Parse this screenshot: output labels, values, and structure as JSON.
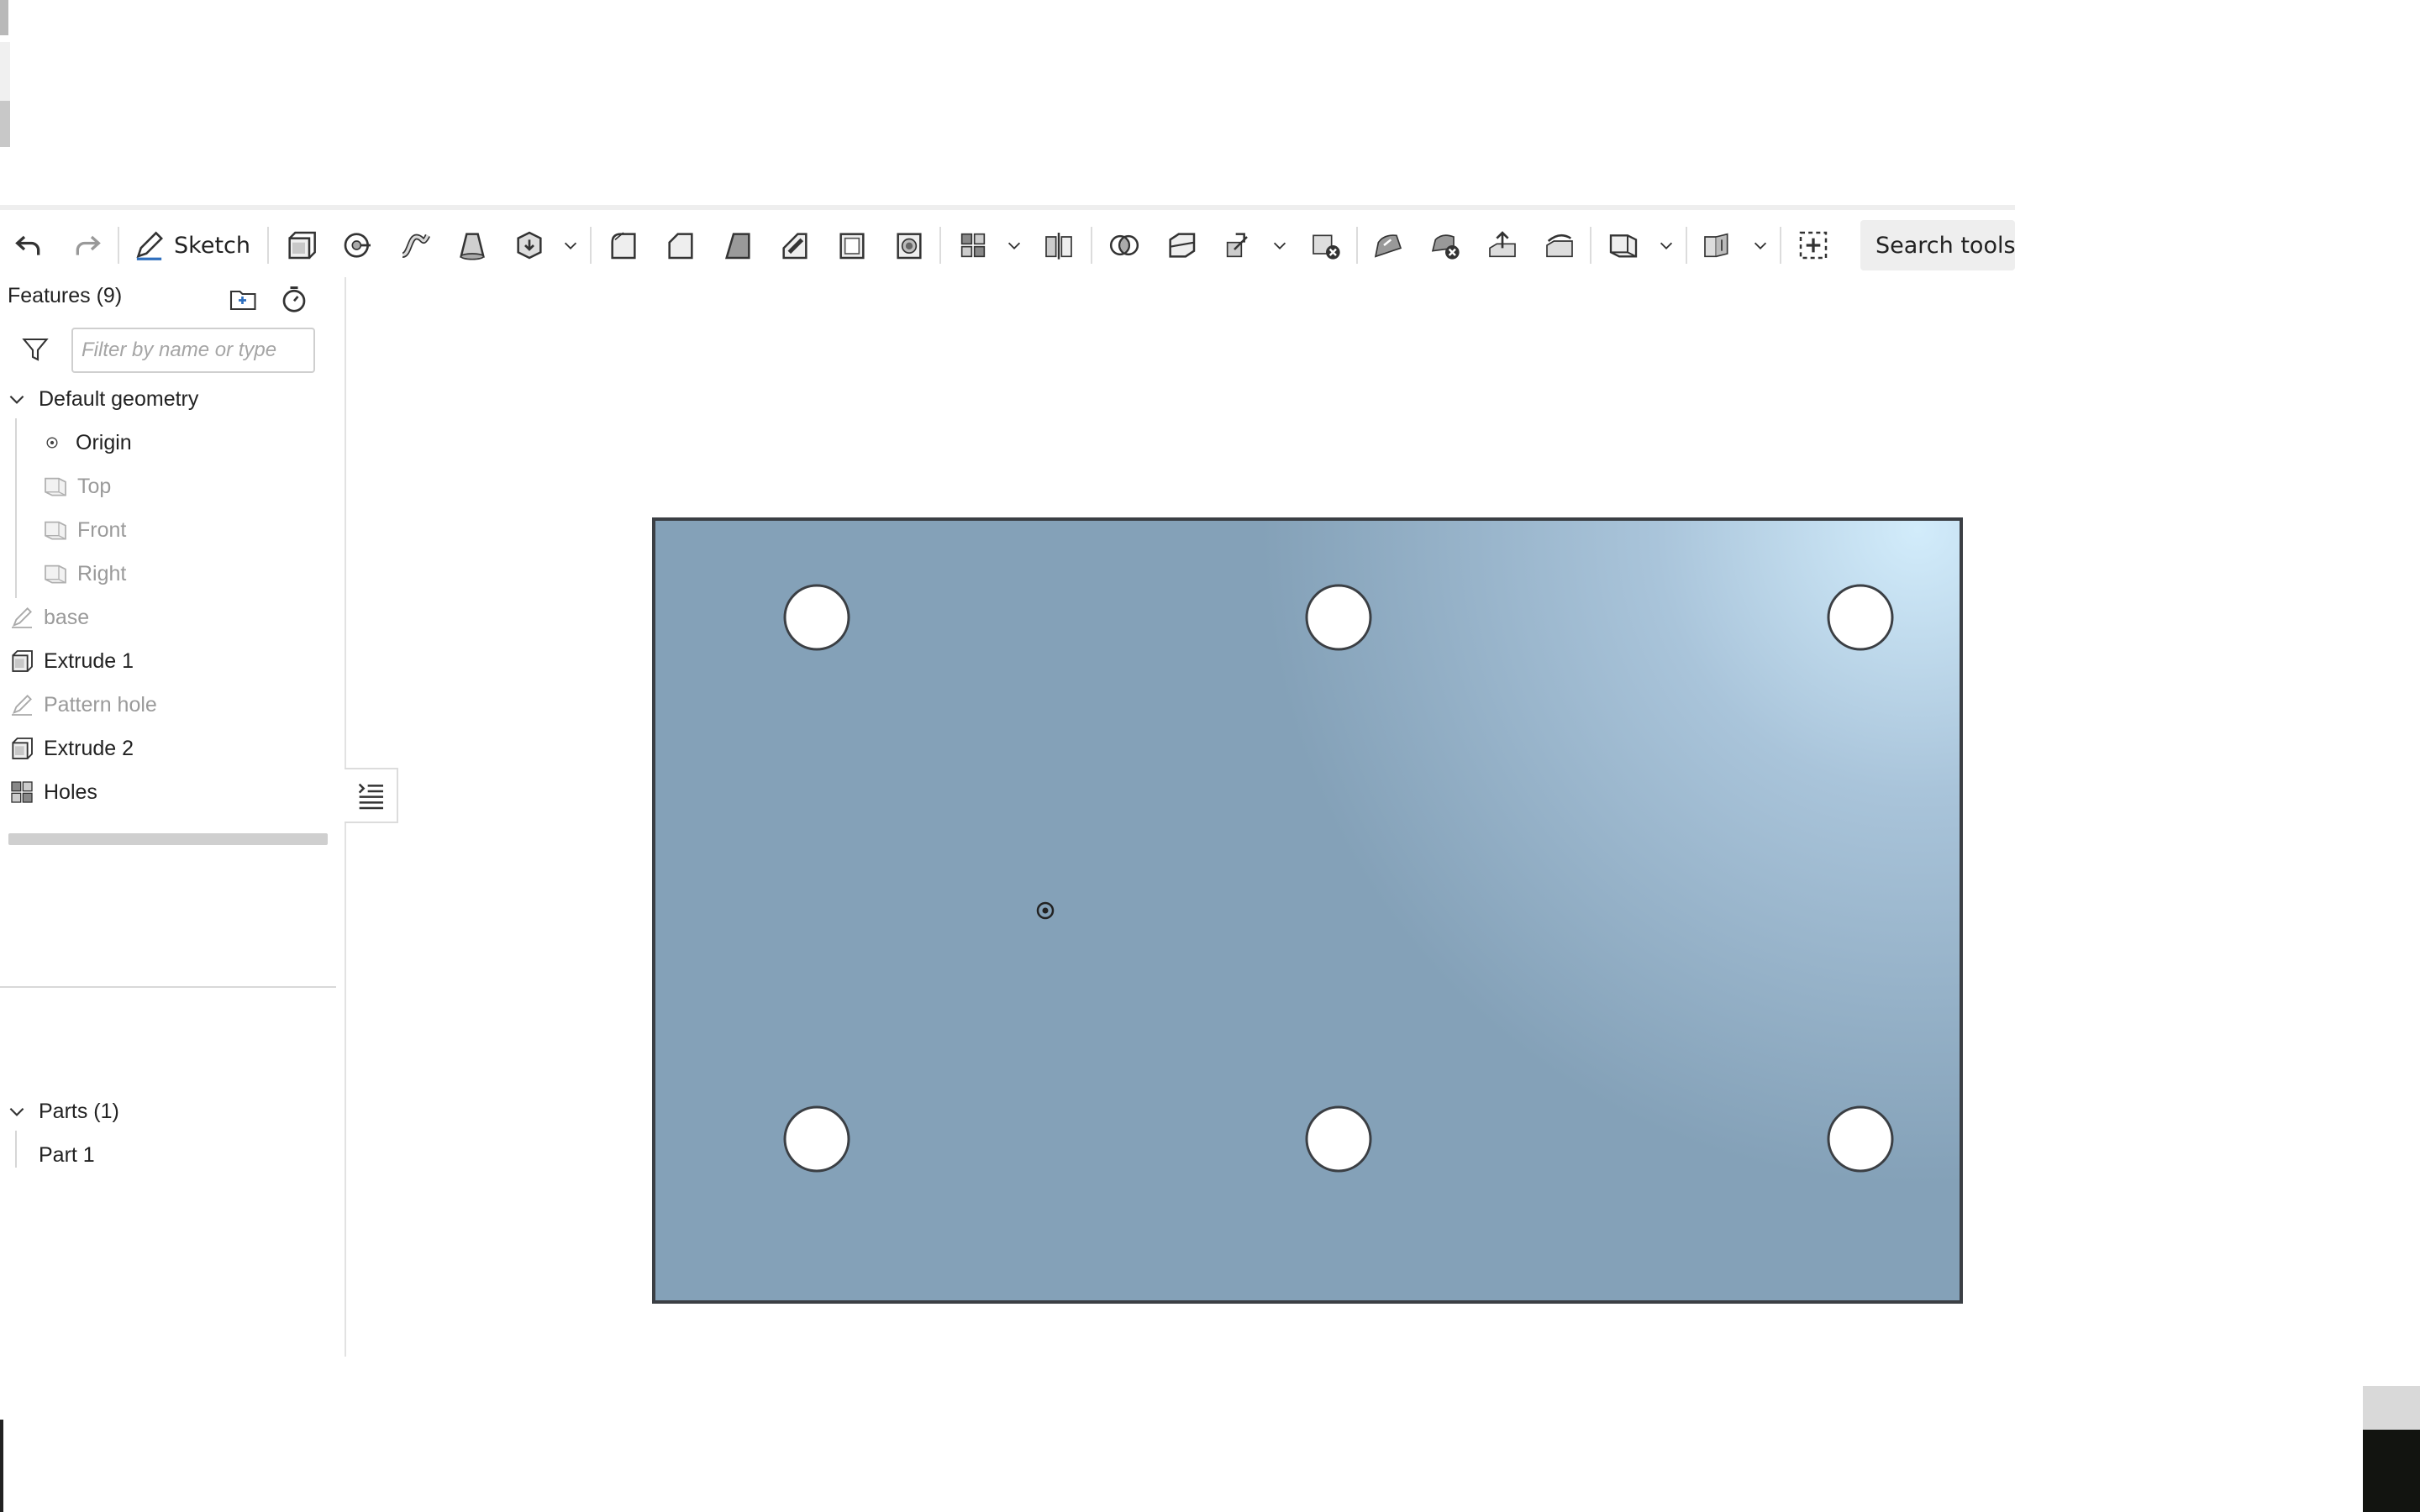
{
  "toolbar": {
    "sketch_label": "Sketch",
    "search_label": "Search tools...",
    "tools": [
      "undo-icon",
      "redo-icon",
      "sketch-icon",
      "extrude-icon",
      "revolve-icon",
      "sweep-icon",
      "loft-icon",
      "thicken-icon",
      "fillet-icon",
      "chamfer-icon",
      "draft-icon",
      "rib-icon",
      "shell-icon",
      "hole-icon",
      "linear-pattern-icon",
      "mirror-icon",
      "boolean-icon",
      "split-icon",
      "transform-icon",
      "delete-part-icon",
      "modify-fillet-icon",
      "delete-face-icon",
      "move-face-icon",
      "replace-face-icon",
      "plane-icon",
      "mate-connector-icon",
      "section-view-icon"
    ]
  },
  "feature_panel": {
    "title": "Features (9)",
    "filter_placeholder": "Filter by name or type",
    "default_geometry": {
      "label": "Default geometry",
      "items": [
        {
          "label": "Origin",
          "icon": "origin-icon",
          "muted": false
        },
        {
          "label": "Top",
          "icon": "plane-icon",
          "muted": true
        },
        {
          "label": "Front",
          "icon": "plane-icon",
          "muted": true
        },
        {
          "label": "Right",
          "icon": "plane-icon",
          "muted": true
        }
      ]
    },
    "features": [
      {
        "label": "base",
        "icon": "sketch-icon",
        "muted": true
      },
      {
        "label": "Extrude 1",
        "icon": "extrude-icon",
        "muted": false
      },
      {
        "label": "Pattern hole",
        "icon": "sketch-icon",
        "muted": true
      },
      {
        "label": "Extrude 2",
        "icon": "extrude-icon",
        "muted": false
      },
      {
        "label": "Holes",
        "icon": "pattern-icon",
        "muted": false
      }
    ],
    "parts": {
      "label": "Parts (1)",
      "items": [
        {
          "label": "Part 1"
        }
      ]
    }
  },
  "colors": {
    "part_fill": "#84a1b8",
    "part_highlight": "#d2ecfb",
    "part_edge": "#3b3f44",
    "accent": "#2f6fbe"
  }
}
